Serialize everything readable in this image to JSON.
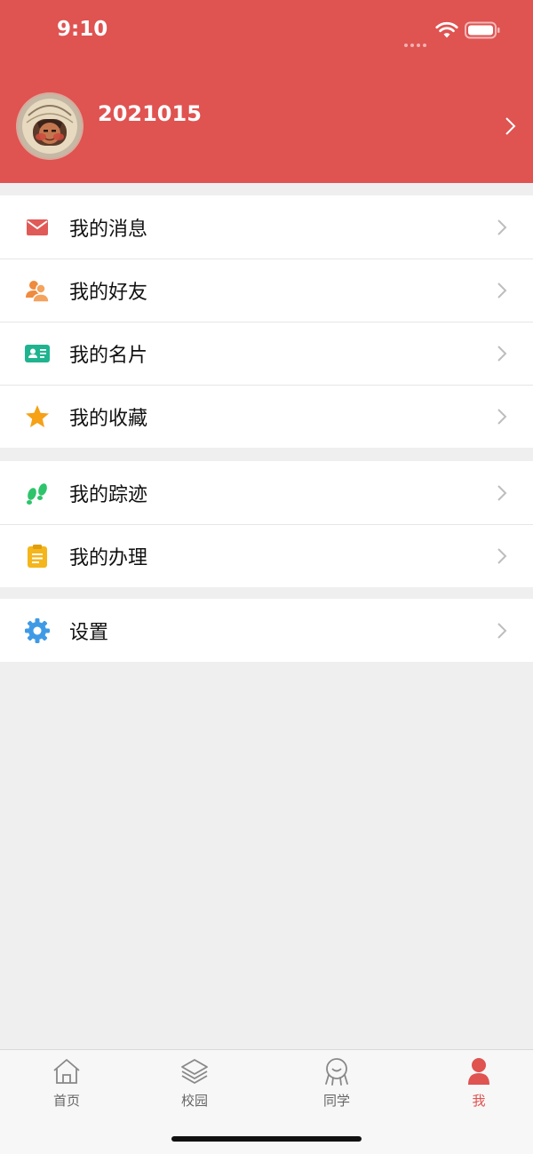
{
  "status_bar": {
    "time": "9:10"
  },
  "profile": {
    "username": "2021015"
  },
  "menu_groups": [
    [
      {
        "label": "我的消息",
        "icon": "mail-icon",
        "color": "#e05a57"
      },
      {
        "label": "我的好友",
        "icon": "friends-icon",
        "color": "#f08a3c"
      },
      {
        "label": "我的名片",
        "icon": "id-card-icon",
        "color": "#1fb48f"
      },
      {
        "label": "我的收藏",
        "icon": "star-icon",
        "color": "#f6a116"
      }
    ],
    [
      {
        "label": "我的踪迹",
        "icon": "footprints-icon",
        "color": "#2ec46b"
      },
      {
        "label": "我的办理",
        "icon": "clipboard-icon",
        "color": "#f5b51c"
      }
    ],
    [
      {
        "label": "设置",
        "icon": "gear-icon",
        "color": "#3f9ae6"
      }
    ]
  ],
  "tabbar": {
    "tabs": [
      {
        "label": "首页",
        "icon": "home-icon"
      },
      {
        "label": "校园",
        "icon": "layers-icon"
      },
      {
        "label": "同学",
        "icon": "classmates-icon"
      },
      {
        "label": "我",
        "icon": "person-icon"
      }
    ],
    "active_color": "#df5351",
    "inactive_color": "#666666"
  },
  "colors": {
    "header": "#df5351",
    "background": "#efefef"
  }
}
